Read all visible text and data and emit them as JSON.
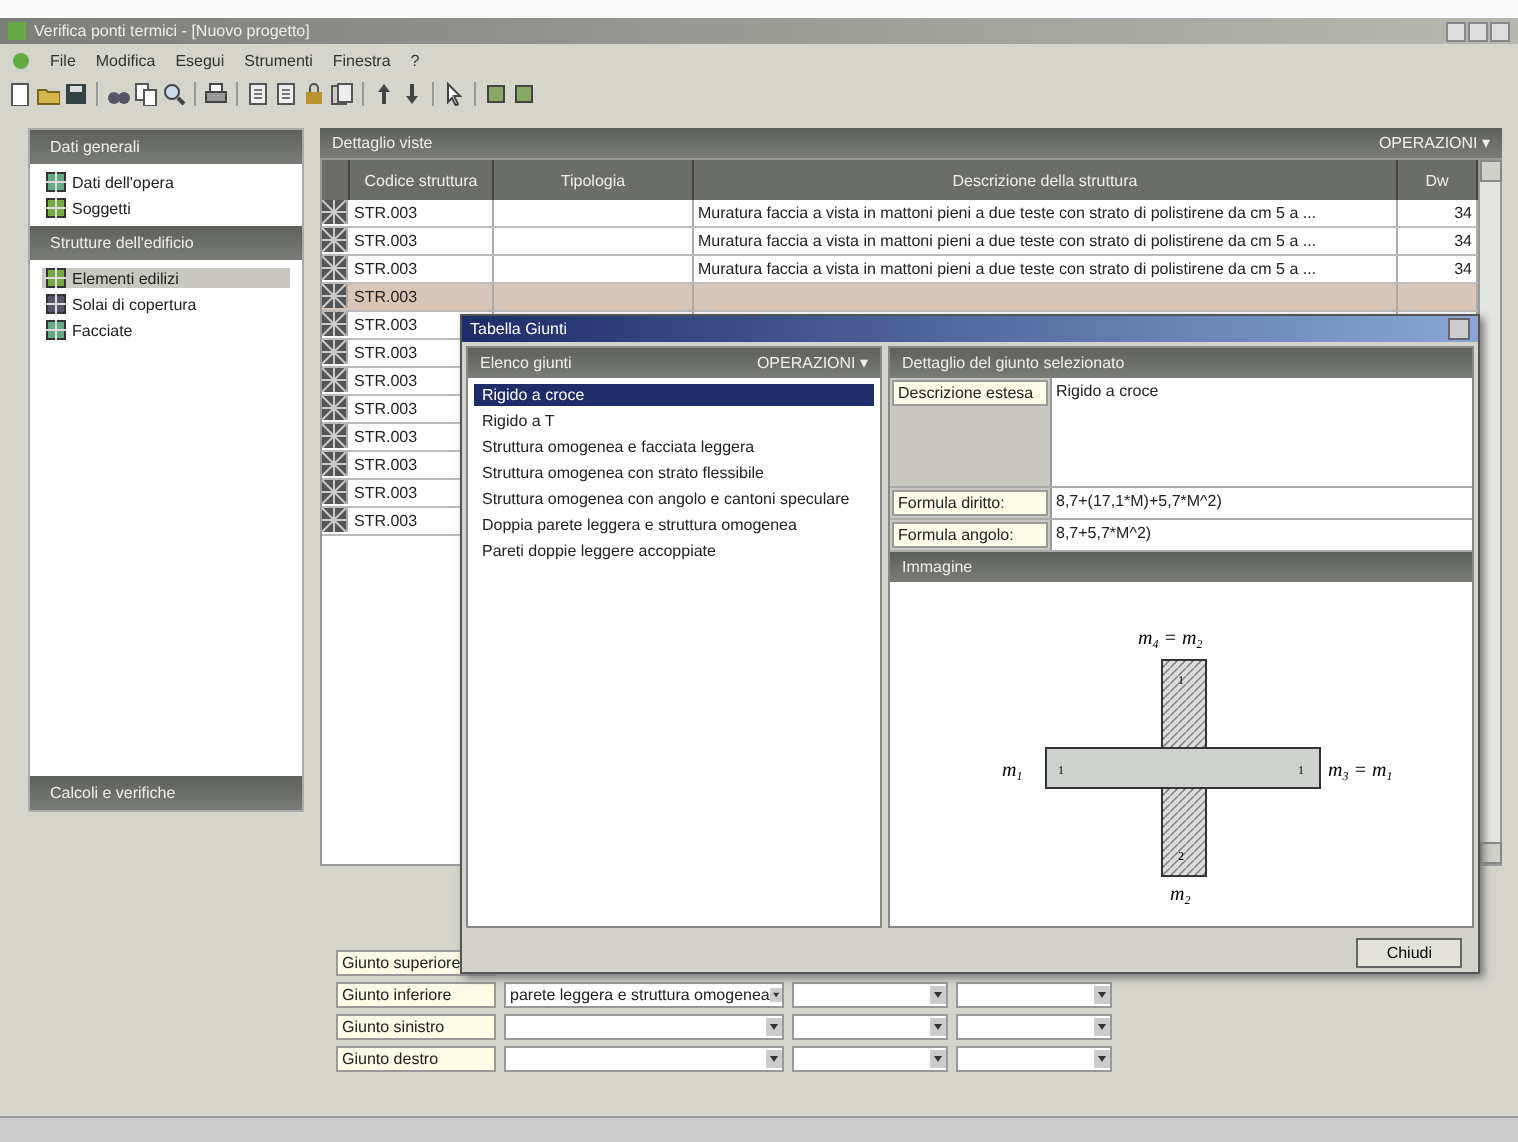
{
  "window": {
    "title": "Verifica ponti termici - [Nuovo progetto]"
  },
  "menu": [
    "File",
    "Modifica",
    "Esegui",
    "Strumenti",
    "Finestra",
    "?"
  ],
  "sidebar": {
    "sections": [
      {
        "title": "Dati generali",
        "items": [
          {
            "label": "Dati dell'opera",
            "selected": false
          },
          {
            "label": "Soggetti",
            "selected": false
          }
        ]
      },
      {
        "title": "Strutture dell'edificio",
        "items": [
          {
            "label": "Elementi edilizi",
            "selected": true
          },
          {
            "label": "Solai di copertura",
            "selected": false
          },
          {
            "label": "Facciate",
            "selected": false
          }
        ]
      },
      {
        "title": "Calcoli e verifiche"
      }
    ]
  },
  "main": {
    "title": "Dettaglio viste",
    "operations": "OPERAZIONI ▾",
    "table": {
      "columns": [
        "Codice struttura",
        "Tipologia",
        "Descrizione della struttura",
        "Dw"
      ],
      "rows": [
        {
          "code": "STR.003",
          "description": "Muratura faccia a vista in mattoni pieni a due teste con strato di polistirene da cm 5 a ...",
          "dw": "34",
          "selected": false
        },
        {
          "code": "STR.003",
          "description": "Muratura faccia a vista in mattoni pieni a due teste con strato di polistirene da cm 5 a ...",
          "dw": "34",
          "selected": false
        },
        {
          "code": "STR.003",
          "description": "Muratura faccia a vista in mattoni pieni a due teste con strato di polistirene da cm 5 a ...",
          "dw": "34",
          "selected": false
        },
        {
          "code": "STR.003",
          "selected": true
        },
        {
          "code": "STR.003",
          "selected": false
        },
        {
          "code": "STR.003",
          "selected": false
        },
        {
          "code": "STR.003",
          "selected": false
        },
        {
          "code": "STR.003",
          "selected": false
        },
        {
          "code": "STR.003",
          "selected": false
        },
        {
          "code": "STR.003",
          "selected": false
        },
        {
          "code": "STR.003",
          "selected": false
        },
        {
          "code": "STR.003",
          "selected": false
        }
      ]
    },
    "joints": [
      {
        "label": "Giunto superiore"
      },
      {
        "label": "Giunto inferiore",
        "combos": [
          {
            "kind": "wide",
            "value": "parete leggera e struttura omogenea"
          },
          {
            "kind": "narrow"
          },
          {
            "kind": "narrow"
          }
        ]
      },
      {
        "label": "Giunto sinistro",
        "combos": [
          {
            "kind": "wide"
          },
          {
            "kind": "narrow"
          },
          {
            "kind": "narrow"
          }
        ]
      },
      {
        "label": "Giunto destro",
        "combos": [
          {
            "kind": "wide"
          },
          {
            "kind": "narrow"
          },
          {
            "kind": "narrow"
          }
        ]
      }
    ]
  },
  "dialog": {
    "title": "Tabella Giunti",
    "list_title": "Elenco giunti",
    "operations": "OPERAZIONI ▾",
    "items": [
      {
        "label": "Rigido a croce",
        "selected": true
      },
      {
        "label": "Rigido a T",
        "selected": false
      },
      {
        "label": "Struttura omogenea e facciata leggera",
        "selected": false
      },
      {
        "label": "Struttura omogenea con strato flessibile",
        "selected": false
      },
      {
        "label": "Struttura omogenea con angolo e cantoni speculare",
        "selected": false
      },
      {
        "label": "Doppia parete leggera e struttura omogenea",
        "selected": false
      },
      {
        "label": "Pareti doppie leggere accoppiate",
        "selected": false
      }
    ],
    "detail_title": "Dettaglio del giunto selezionato",
    "fields": [
      {
        "label": "Descrizione estesa",
        "value": "Rigido a croce",
        "kind": "tall"
      },
      {
        "label": "Formula diritto:",
        "value": "8,7+(17,1*M)+5,7*M^2)",
        "kind": "line"
      },
      {
        "label": "Formula angolo:",
        "value": "8,7+5,7*M^2)",
        "kind": "line"
      }
    ],
    "image_title": "Immagine",
    "diagram": {
      "top": "m",
      "top_sub": "4",
      "top_eq": " = m",
      "top_eq_sub": "2",
      "left": "m",
      "left_sub": "1",
      "right": "m",
      "right_sub": "3",
      "right_eq": " = m",
      "right_eq_sub": "1",
      "bottom": "m",
      "bottom_sub": "2",
      "marks": [
        "1",
        "1",
        "1",
        "2"
      ]
    },
    "close": "Chiudi"
  }
}
